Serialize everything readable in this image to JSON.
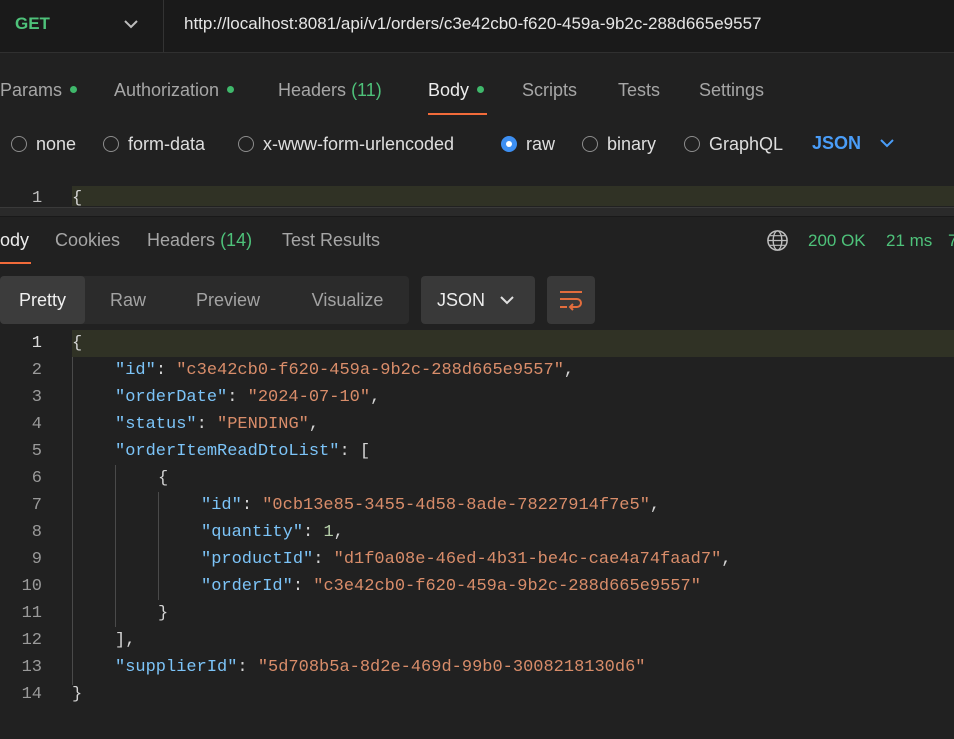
{
  "request": {
    "method": "GET",
    "url": "http://localhost:8081/api/v1/orders/c3e42cb0-f620-459a-9b2c-288d665e9557",
    "tabs": [
      {
        "label": "Params",
        "dot": true
      },
      {
        "label": "Authorization",
        "dot": true
      },
      {
        "label": "Headers",
        "count": "(11)"
      },
      {
        "label": "Body",
        "dot": true,
        "active": true
      },
      {
        "label": "Scripts"
      },
      {
        "label": "Tests"
      },
      {
        "label": "Settings"
      }
    ],
    "body_types": [
      "none",
      "form-data",
      "x-www-form-urlencoded",
      "raw",
      "binary",
      "GraphQL"
    ],
    "body_type_selected": "raw",
    "body_format": "JSON",
    "editor_line": "1",
    "editor_text": "{"
  },
  "response": {
    "tabs": [
      {
        "label": "ody",
        "active": true
      },
      {
        "label": "Cookies"
      },
      {
        "label": "Headers",
        "count": "(14)"
      },
      {
        "label": "Test Results"
      }
    ],
    "status": "200 OK",
    "time": "21 ms",
    "size": "7",
    "view_modes": [
      "Pretty",
      "Raw",
      "Preview",
      "Visualize"
    ],
    "view_mode_selected": "Pretty",
    "language": "JSON",
    "line_numbers": [
      "1",
      "2",
      "3",
      "4",
      "5",
      "6",
      "7",
      "8",
      "9",
      "10",
      "11",
      "12",
      "13",
      "14"
    ],
    "body": {
      "id": "c3e42cb0-f620-459a-9b2c-288d665e9557",
      "orderDate": "2024-07-10",
      "status": "PENDING",
      "item": {
        "id": "0cb13e85-3455-4d58-8ade-78227914f7e5",
        "quantity": "1",
        "productId": "d1f0a08e-46ed-4b31-be4c-cae4a74faad7",
        "orderId": "c3e42cb0-f620-459a-9b2c-288d665e9557"
      },
      "supplierId": "5d708b5a-8d2e-469d-99b0-3008218130d6"
    },
    "keys": {
      "id": "\"id\"",
      "orderDate": "\"orderDate\"",
      "status": "\"status\"",
      "list": "\"orderItemReadDtoList\"",
      "quantity": "\"quantity\"",
      "productId": "\"productId\"",
      "orderId": "\"orderId\"",
      "supplierId": "\"supplierId\""
    }
  },
  "colors": {
    "accent": "#f26b3a",
    "success": "#4ec27a",
    "link": "#4a9df8"
  }
}
